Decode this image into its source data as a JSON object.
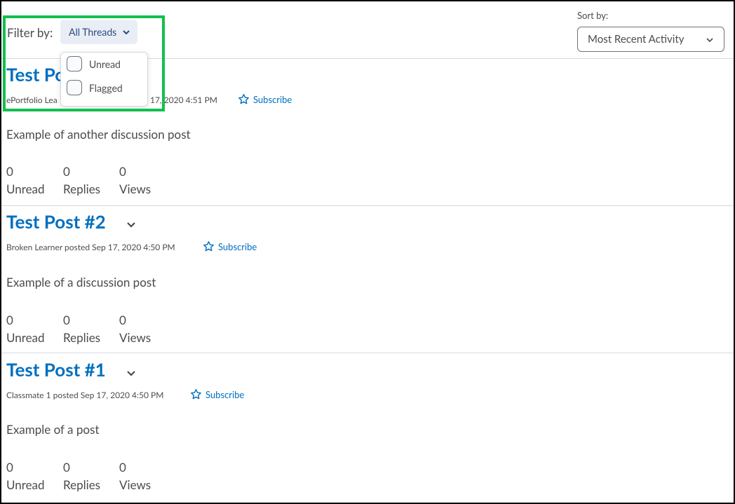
{
  "filter": {
    "label": "Filter by:",
    "button_label": "All Threads"
  },
  "sort": {
    "label": "Sort by:",
    "selected": "Most Recent Activity"
  },
  "dropdown": {
    "items": [
      {
        "label": "Unread"
      },
      {
        "label": "Flagged"
      }
    ]
  },
  "posts": [
    {
      "title": "Test Po",
      "meta_left": "ePortfolio Lea",
      "meta_right": "17, 2020 4:51 PM",
      "subscribe": "Subscribe",
      "body": "Example of another discussion post",
      "stats": [
        {
          "value": "0",
          "label": "Unread"
        },
        {
          "value": "0",
          "label": "Replies"
        },
        {
          "value": "0",
          "label": "Views"
        }
      ]
    },
    {
      "title": "Test Post #2",
      "meta": "Broken Learner posted Sep 17, 2020 4:50 PM",
      "subscribe": "Subscribe",
      "body": "Example of a discussion post",
      "stats": [
        {
          "value": "0",
          "label": "Unread"
        },
        {
          "value": "0",
          "label": "Replies"
        },
        {
          "value": "0",
          "label": "Views"
        }
      ]
    },
    {
      "title": "Test Post #1",
      "meta": "Classmate 1 posted Sep 17, 2020 4:50 PM",
      "subscribe": "Subscribe",
      "body": "Example of a post",
      "stats": [
        {
          "value": "0",
          "label": "Unread"
        },
        {
          "value": "0",
          "label": "Replies"
        },
        {
          "value": "0",
          "label": "Views"
        }
      ]
    }
  ],
  "colors": {
    "link": "#006fbf",
    "highlight": "#13c04f",
    "filter_bg": "#e9eef6"
  }
}
